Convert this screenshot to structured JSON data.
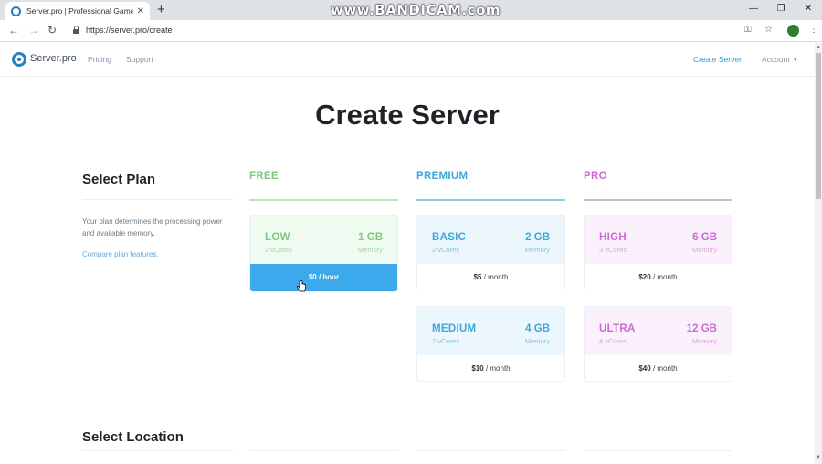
{
  "browser": {
    "tab_title": "Server.pro | Professional Game S",
    "tab_close": "✕",
    "new_tab": "+",
    "watermark": "www.BANDICAM.com",
    "url": "https://server.pro/create",
    "controls": {
      "minimize": "—",
      "restore": "❐",
      "close": "✕"
    }
  },
  "header": {
    "logo_text": "Server.pro",
    "nav": [
      "Pricing",
      "Support"
    ],
    "right_nav": {
      "create": "Create Server",
      "account": "Account"
    }
  },
  "page": {
    "title": "Create Server",
    "select_plan": {
      "title": "Select Plan",
      "description": "Your plan determines the processing power and available memory.",
      "compare_link": "Compare plan features."
    },
    "select_location": {
      "title": "Select Location"
    }
  },
  "plans": {
    "columns": [
      {
        "name": "FREE",
        "color": "#7dc983"
      },
      {
        "name": "PREMIUM",
        "color": "#3fa6d9"
      },
      {
        "name": "PRO",
        "color": "#c96bd1"
      }
    ],
    "low": {
      "name": "LOW",
      "memory": "1 GB",
      "cores": "2 vCores",
      "mem_label": "Memory",
      "price": "$0 / hour",
      "selected": true
    },
    "basic": {
      "name": "BASIC",
      "memory": "2 GB",
      "cores": "2 vCores",
      "mem_label": "Memory",
      "price_amount": "$5",
      "price_unit": " / month"
    },
    "high": {
      "name": "HIGH",
      "memory": "6 GB",
      "cores": "3 vCores",
      "mem_label": "Memory",
      "price_amount": "$20",
      "price_unit": " / month"
    },
    "medium": {
      "name": "MEDIUM",
      "memory": "4 GB",
      "cores": "2 vCores",
      "mem_label": "Memory",
      "price_amount": "$10",
      "price_unit": " / month"
    },
    "ultra": {
      "name": "ULTRA",
      "memory": "12 GB",
      "cores": "4 vCores",
      "mem_label": "Memory",
      "price_amount": "$40",
      "price_unit": " / month"
    }
  },
  "colors": {
    "accent_blue": "#3ba9ec",
    "free": "#7dc983",
    "premium": "#3fa6d9",
    "pro": "#c96bd1"
  }
}
